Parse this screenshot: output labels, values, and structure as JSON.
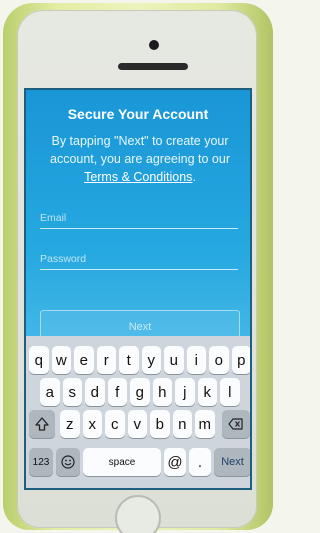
{
  "screen": {
    "title": "Secure Your Account",
    "description": "By tapping \"Next\" to create your account, you are agreeing to our",
    "terms_link": "Terms & Conditions",
    "terms_suffix": ".",
    "email_placeholder": "Email",
    "password_placeholder": "Password",
    "next_button": "Next"
  },
  "keyboard": {
    "row1": [
      "q",
      "w",
      "e",
      "r",
      "t",
      "y",
      "u",
      "i",
      "o",
      "p"
    ],
    "row2": [
      "a",
      "s",
      "d",
      "f",
      "g",
      "h",
      "j",
      "k",
      "l"
    ],
    "row3": [
      "z",
      "x",
      "c",
      "v",
      "b",
      "n",
      "m"
    ],
    "numbers_key": "123",
    "space_key": "space",
    "at_key": "@",
    "dot_key": ".",
    "next_key": "Next",
    "icons": [
      "shift-icon",
      "backspace-icon",
      "emoji-icon"
    ]
  },
  "colors": {
    "screen_top": "#1a96d6",
    "screen_bottom": "#7ccbe8",
    "keyboard_bg": "#cfd5dc",
    "case": "#e4eda4"
  }
}
